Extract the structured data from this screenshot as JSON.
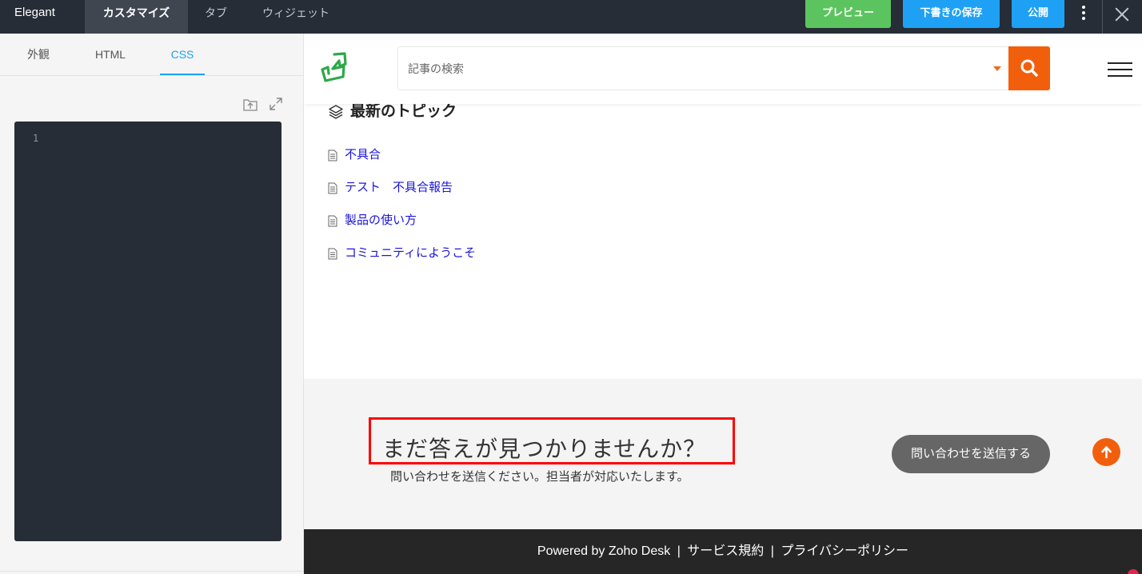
{
  "topbar": {
    "brand": "Elegant",
    "nav": [
      "カスタマイズ",
      "タブ",
      "ウィジェット"
    ],
    "preview_label": "プレビュー",
    "draft_label": "下書きの保存",
    "publish_label": "公開"
  },
  "left_panel": {
    "tabs": [
      "外観",
      "HTML",
      "CSS"
    ],
    "active_tab": "CSS",
    "editor": {
      "line_numbers": [
        "1"
      ]
    }
  },
  "preview": {
    "search": {
      "placeholder": "記事の検索"
    },
    "section_title": "最新のトピック",
    "topics": [
      "不具合",
      "テスト　不具合報告",
      "製品の使い方",
      "コミュニティにようこそ"
    ],
    "cta": {
      "title": "まだ答えが見つかりませんか？",
      "subtitle": "問い合わせを送信ください。担当者が対応いたします。",
      "button": "問い合わせを送信する"
    },
    "footer": {
      "powered": "Powered by Zoho Desk",
      "sep": "|",
      "terms": "サービス規約",
      "privacy": "プライバシーポリシー"
    }
  },
  "colors": {
    "topbar_bg": "#262d36",
    "preview_btn": "#5cc45f",
    "action_btn": "#1ea1f5",
    "accent_orange": "#f25f0c",
    "link_blue": "#1b14dd",
    "highlight_red": "#ff0000"
  },
  "icons": [
    "kebab-menu-icon",
    "close-icon",
    "upload-icon",
    "expand-icon",
    "logo-icon",
    "dropdown-caret-icon",
    "search-icon",
    "hamburger-icon",
    "layers-icon",
    "document-icon",
    "arrow-up-icon"
  ]
}
